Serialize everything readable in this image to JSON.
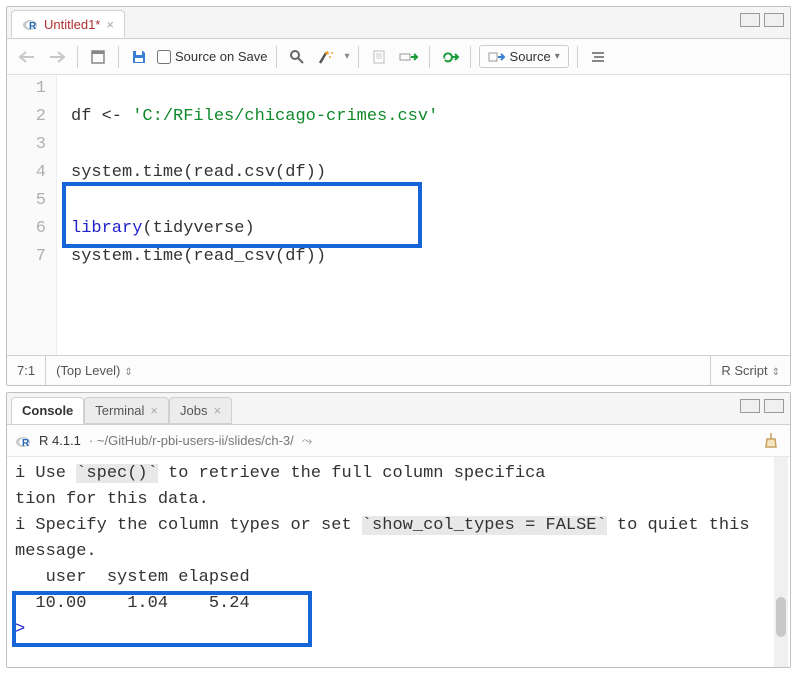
{
  "editor": {
    "tab_title": "Untitled1*",
    "cursor": "7:1",
    "scope": "(Top Level)",
    "language": "R Script",
    "source_on_save": "Source on Save",
    "source_btn": "Source",
    "lines": [
      "1",
      "2",
      "3",
      "4",
      "5",
      "6",
      "7"
    ],
    "code": {
      "l1_a": "df <- ",
      "l1_b": "'C:/RFiles/chicago-crimes.csv'",
      "l3": "system.time(read.csv(df))",
      "l5_a": "library",
      "l5_b": "(tidyverse)",
      "l6": "system.time(read_csv(df))"
    }
  },
  "console_tabs": {
    "console": "Console",
    "terminal": "Terminal",
    "jobs": "Jobs"
  },
  "console": {
    "version": "R 4.1.1",
    "path": "~/GitHub/r-pbi-users-ii/slides/ch-3/",
    "out1_a": "i Use ",
    "out1_b": "`spec()`",
    "out1_c": " to retrieve the full column specifica",
    "out2": "tion for this data.",
    "out3_a": "i Specify the column types or set ",
    "out3_b": "`show_col_types = FALSE`",
    "out3_c": " to quiet this message.",
    "timing_hdr": "   user  system elapsed ",
    "timing_val": "  10.00    1.04    5.24 ",
    "prompt": ">"
  }
}
